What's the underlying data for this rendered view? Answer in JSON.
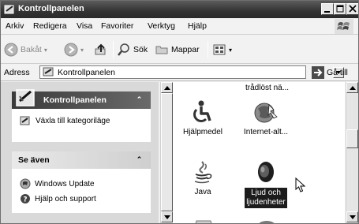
{
  "window": {
    "title": "Kontrollpanelen"
  },
  "menu": [
    "Arkiv",
    "Redigera",
    "Visa",
    "Favoriter",
    "Verktyg",
    "Hjälp"
  ],
  "toolbar": {
    "back": "Bakåt",
    "search": "Sök",
    "folders": "Mappar"
  },
  "address": {
    "label": "Adress",
    "value": "Kontrollpanelen",
    "go": "Gå till"
  },
  "taskpane": {
    "header": "Kontrollpanelen",
    "switch_link": "Växla till kategoriläge",
    "see_also_header": "Se även",
    "see_also": [
      "Windows Update",
      "Hjälp och support"
    ]
  },
  "content": {
    "partial_top_label": "trådlöst nä...",
    "items": [
      {
        "label": "Hjälpmedel",
        "icon": "accessibility-icon"
      },
      {
        "label": "Internet-alt...",
        "icon": "internet-options-icon"
      },
      {
        "label": "Java",
        "icon": "java-icon"
      },
      {
        "label_line1": "Ljud och",
        "label_line2": "ljudenheter",
        "icon": "speaker-icon",
        "selected": true
      }
    ]
  }
}
